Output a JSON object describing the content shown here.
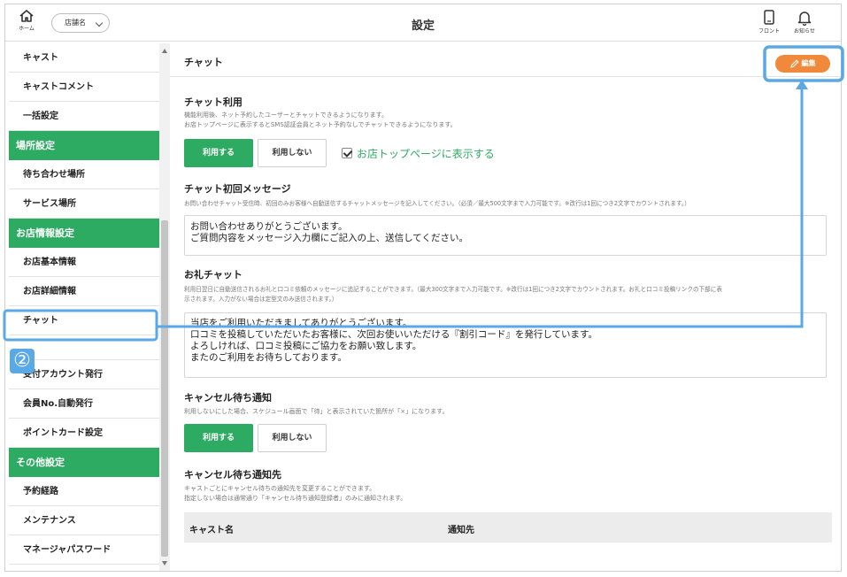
{
  "header": {
    "home_label": "ホーム",
    "store_name": "店舗名",
    "title": "設定",
    "front_label": "フロント",
    "notice_label": "お知らせ"
  },
  "sidebar": {
    "items": [
      {
        "type": "item",
        "label": "キャスト"
      },
      {
        "type": "item",
        "label": "キャストコメント"
      },
      {
        "type": "item",
        "label": "一括設定"
      },
      {
        "type": "section",
        "label": "場所設定"
      },
      {
        "type": "item",
        "label": "待ち合わせ場所"
      },
      {
        "type": "item",
        "label": "サービス場所"
      },
      {
        "type": "section",
        "label": "お店情報設定"
      },
      {
        "type": "item",
        "label": "お店基本情報"
      },
      {
        "type": "item",
        "label": "お店詳細情報"
      },
      {
        "type": "item",
        "label": "チャット"
      },
      {
        "type": "item",
        "label": "受付アカウント発行"
      },
      {
        "type": "item",
        "label": "会員No.自動発行"
      },
      {
        "type": "item",
        "label": "ポイントカード設定"
      },
      {
        "type": "section",
        "label": "その他設定"
      },
      {
        "type": "item",
        "label": "予約経路"
      },
      {
        "type": "item",
        "label": "メンテナンス"
      },
      {
        "type": "item",
        "label": "マネージャパスワード"
      }
    ]
  },
  "main": {
    "title": "チャット",
    "edit_label": "編集",
    "chat_use": {
      "title": "チャット利用",
      "help": [
        "機能利用後、ネット予約したユーザーとチャットできるようになります。",
        "お店トップページに表示するとSMS認証会員とネット予約なしでチャットできるようになります。"
      ],
      "use_label": "利用する",
      "nouse_label": "利用しない",
      "checkbox_label": "お店トップページに表示する"
    },
    "first_message": {
      "title": "チャット初回メッセージ",
      "help": "お問い合わせチャット受信時、初回のみお客様へ自動送信するチャットメッセージを記入してください。（必須／最大500文字まで入力可能です。※改行は1回につき2文字でカウントされます。）",
      "lines": [
        "お問い合わせありがとうございます。",
        "ご質問内容をメッセージ入力欄にご記入の上、送信してください。"
      ]
    },
    "thanks_chat": {
      "title": "お礼チャット",
      "help": [
        "利用日翌日に自動送信されるお礼と口コミ依頼のメッセージに追記することができます。（最大300文字まで入力可能です。※改行は1回につき2文字でカウントされます。お礼と口コミ投稿リンクの下部に表",
        "示されます。入力がない場合は定型文のみ送信されます。）"
      ],
      "lines": [
        "当店をご利用いただきましてありがとうございます。",
        "口コミを投稿していただいたお客様に、次回お使いいただける『割引コード』を発行しています。",
        "よろしければ、口コミ投稿にご協力をお願い致します。",
        "またのご利用をお待ちしております。"
      ]
    },
    "cancel_notice": {
      "title": "キャンセル待ち通知",
      "help": "利用しないにした場合、スケジュール画面で「待」と表示されていた箇所が「×」になります。",
      "use_label": "利用する",
      "nouse_label": "利用しない"
    },
    "cancel_target": {
      "title": "キャンセル待ち通知先",
      "help": [
        "キャストごとにキャンセル待ちの通知先を変更することができます。",
        "指定しない場合は通常通り「キャンセル待ち通知登録者」のみに通知されます。"
      ],
      "col_cast": "キャスト名",
      "col_target": "通知先"
    }
  },
  "annotation": {
    "step_number": "②",
    "color": "#5aa8e6"
  },
  "colors": {
    "green": "#2eab62",
    "orange": "#f08a3a"
  }
}
